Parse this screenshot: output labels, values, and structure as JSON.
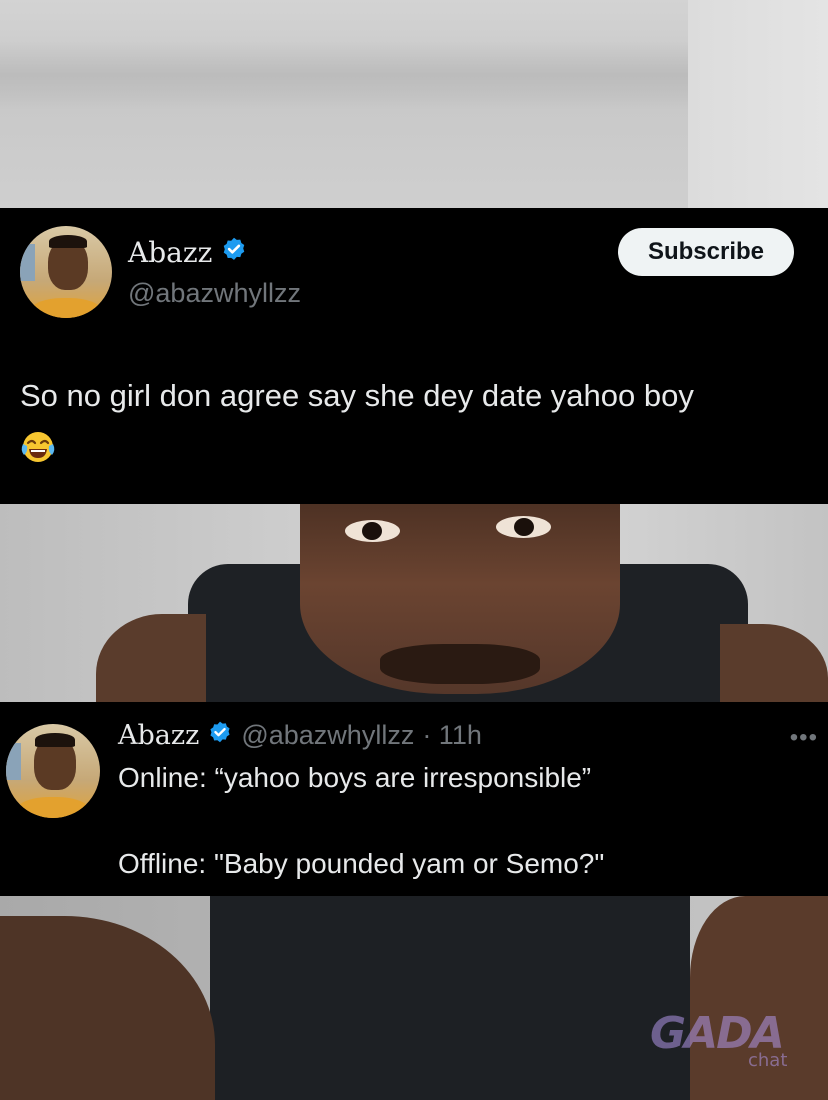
{
  "tweet_1": {
    "display_name": "Abazz",
    "handle": "@abazwhyllzz",
    "subscribe_label": "Subscribe",
    "text": "So no girl don agree say she dey date yahoo boy",
    "emoji": "face-with-tears-of-joy"
  },
  "tweet_2": {
    "display_name": "Abazz",
    "handle": "@abazwhyllzz",
    "time": "· 11h",
    "more_label": "•••",
    "line_1": "Online: “yahoo boys are irresponsible”",
    "line_2": "Offline: \"Baby pounded yam or Semo?\""
  },
  "watermark": {
    "main": "GADA",
    "sub": "chat"
  },
  "colors": {
    "card_bg": "#000000",
    "verified_blue": "#1d9bf0",
    "handle_gray": "#71767b",
    "subscribe_bg": "#eff3f4"
  }
}
